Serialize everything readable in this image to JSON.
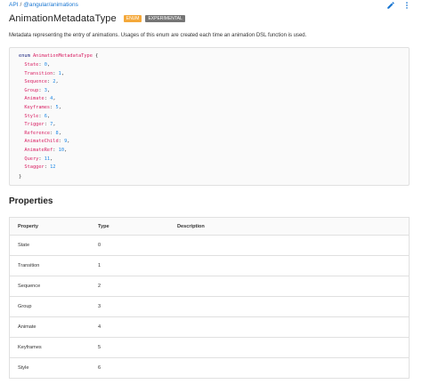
{
  "breadcrumb": {
    "root": "API",
    "separator": "/",
    "package": "@angular/animations"
  },
  "title": "AnimationMetadataType",
  "badges": {
    "type": "ENUM",
    "status": "EXPERIMENTAL"
  },
  "description": "Metadata representing the entry of animations. Usages of this enum are created each time an animation DSL function is used.",
  "code": {
    "keyword": "enum",
    "name": "AnimationMetadataType",
    "open": "{",
    "close": "}",
    "members": [
      {
        "name": "State",
        "value": "0"
      },
      {
        "name": "Transition",
        "value": "1"
      },
      {
        "name": "Sequence",
        "value": "2"
      },
      {
        "name": "Group",
        "value": "3"
      },
      {
        "name": "Animate",
        "value": "4"
      },
      {
        "name": "Keyframes",
        "value": "5"
      },
      {
        "name": "Style",
        "value": "6"
      },
      {
        "name": "Trigger",
        "value": "7"
      },
      {
        "name": "Reference",
        "value": "8"
      },
      {
        "name": "AnimateChild",
        "value": "9"
      },
      {
        "name": "AnimateRef",
        "value": "10"
      },
      {
        "name": "Query",
        "value": "11"
      },
      {
        "name": "Stagger",
        "value": "12"
      }
    ]
  },
  "properties": {
    "section_title": "Properties",
    "headers": [
      "Property",
      "Type",
      "Description"
    ],
    "rows": [
      {
        "property": "State",
        "type": "0",
        "description": ""
      },
      {
        "property": "Transition",
        "type": "1",
        "description": ""
      },
      {
        "property": "Sequence",
        "type": "2",
        "description": ""
      },
      {
        "property": "Group",
        "type": "3",
        "description": ""
      },
      {
        "property": "Animate",
        "type": "4",
        "description": ""
      },
      {
        "property": "Keyframes",
        "type": "5",
        "description": ""
      },
      {
        "property": "Style",
        "type": "6",
        "description": ""
      }
    ]
  },
  "colors": {
    "link": "#1976d2",
    "badge_enum": "#f4a83a",
    "badge_experimental": "#757575",
    "code_member": "#d81b60",
    "code_number": "#1e88e5"
  },
  "icons": {
    "edit": "pencil-icon",
    "more": "more-vert-icon"
  }
}
